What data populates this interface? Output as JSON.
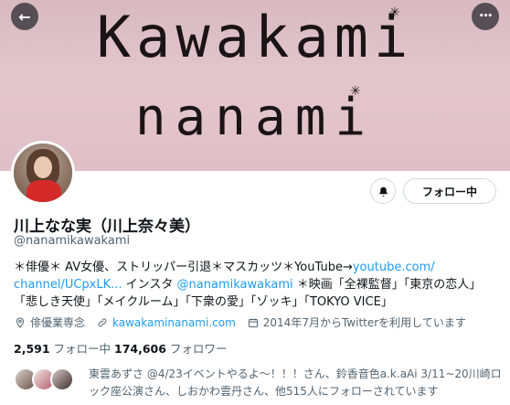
{
  "banner": {
    "line1": "Kawakami",
    "line2": "nanami"
  },
  "icons": {
    "back": "back-arrow-icon",
    "more": "more-dots-icon",
    "bell": "bell-icon",
    "location": "location-icon",
    "link": "link-icon",
    "calendar": "calendar-icon"
  },
  "header": {
    "back_glyph": "←",
    "more_glyph": "•••"
  },
  "actions": {
    "bell_glyph": "🔔",
    "follow_label": "フォロー中"
  },
  "profile": {
    "name": "川上なな実（川上奈々美）",
    "handle": "@nanamikawakami"
  },
  "bio": {
    "line1_text": "＊俳優＊ AV女優、ストリッパー引退＊マスカッツ＊YouTube→",
    "line1_link": "youtube.com/",
    "line2_link": "channel/UCpxLK...",
    "line2_text": " インスタ ",
    "line2_link2": "@nanamikawakami",
    "line2_text2": " ＊映画「全裸監督」「東京の恋人」",
    "line3": "「悲しき天使」「メイクルーム」「下衆の愛」「ゾッキ」「TOKYO VICE」"
  },
  "meta": {
    "location": "俳優業専念",
    "website": "kawakaminanami.com",
    "joined": "2014年7月からTwitterを利用しています"
  },
  "stats": {
    "following_count": "2,591",
    "following_label": " フォロー中 ",
    "followers_count": "174,606",
    "followers_label": " フォロワー"
  },
  "followed_by": {
    "text": "東雲あずさ @4/23イベントやるよ〜！！！さん、鈴香音色a.k.aAi 3/11~20川崎ロック座公演さん、しおかわ雲丹さん、他515人にフォローされています"
  },
  "colors": {
    "accent": "#1d9bf0",
    "text": "#0f1419",
    "muted": "#536471"
  }
}
